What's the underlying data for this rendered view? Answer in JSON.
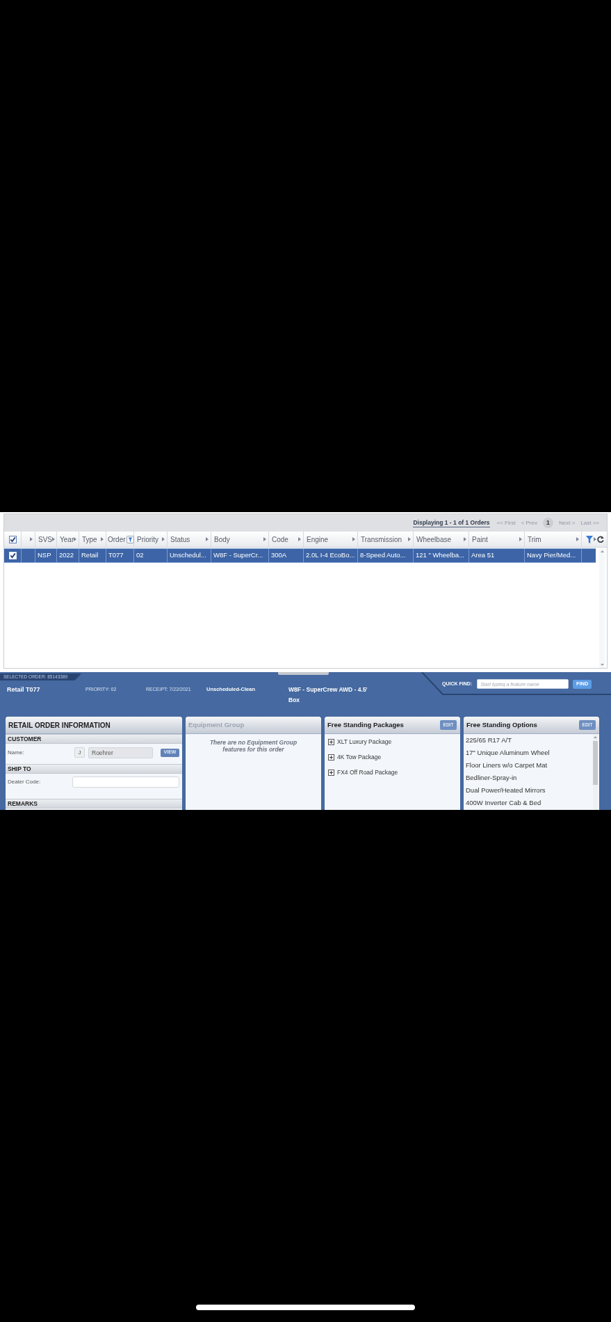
{
  "grid": {
    "pager": {
      "summary": "Displaying 1 - 1 of 1 Orders",
      "nav": [
        {
          "kind": "link",
          "label": "<< First",
          "disabled": true
        },
        {
          "kind": "link",
          "label": "< Prev",
          "disabled": true
        },
        {
          "kind": "page",
          "label": "1",
          "selected": true
        },
        {
          "kind": "link",
          "label": "Next >",
          "disabled": true
        },
        {
          "kind": "link",
          "label": "Last >>",
          "disabled": true
        }
      ]
    },
    "select_all_checked": true,
    "columns": [
      {
        "label": "SVS",
        "filter": false
      },
      {
        "label": "Year",
        "filter": false
      },
      {
        "label": "Type",
        "filter": false
      },
      {
        "label": "Order",
        "filter": true
      },
      {
        "label": "Priority",
        "filter": false
      },
      {
        "label": "Status",
        "filter": false
      },
      {
        "label": "Body",
        "filter": false
      },
      {
        "label": "Code",
        "filter": false
      },
      {
        "label": "Engine",
        "filter": false
      },
      {
        "label": "Transmission",
        "filter": false
      },
      {
        "label": "Wheelbase",
        "filter": false
      },
      {
        "label": "Paint",
        "filter": false
      },
      {
        "label": "Trim",
        "filter": false
      }
    ],
    "rows": [
      {
        "selected": true,
        "checked": true,
        "cells": [
          "NSP",
          "2022",
          "Retail",
          "T077",
          "02",
          "Unschedul...",
          "W8F - SuperCr...",
          "300A",
          "2.0L I-4 EcoBo...",
          "8-Speed Auto...",
          "121 \" Wheelba...",
          "Area 51",
          "Navy Pier/Med..."
        ]
      }
    ]
  },
  "selected_order": {
    "tab": "SELECTED ORDER: 85143389",
    "title": "Retail T077",
    "priority": "PRIORITY: 02",
    "receipt": "RECEIPT: 7/22/2021",
    "status": "Unscheduled-Clean",
    "body": "W8F - SuperCrew AWD - 4.5' Box"
  },
  "quick_find": {
    "label": "QUICK FIND:",
    "placeholder": "Start typing a feature name",
    "button": "FIND"
  },
  "order_info": {
    "title": "RETAIL ORDER INFORMATION",
    "customer": {
      "heading": "CUSTOMER",
      "label": "Name:",
      "initial": "J",
      "name": "Roehrer",
      "button": "VIEW"
    },
    "ship_to": {
      "heading": "SHIP TO",
      "label": "Dealer Code:"
    },
    "remarks": {
      "heading": "REMARKS"
    }
  },
  "equipment_group": {
    "title": "Equipment Group",
    "disabled": true,
    "message": "There are no Equipment Group features for this order"
  },
  "packages": {
    "title": "Free Standing Packages",
    "button": "EDIT",
    "items": [
      {
        "label": "XLT Luxury Package",
        "expanded": false
      },
      {
        "label": "4K Tow Package",
        "expanded": false
      },
      {
        "label": "FX4 Off Road Package",
        "expanded": false
      }
    ]
  },
  "options": {
    "title": "Free Standing Options",
    "button": "EDIT",
    "items": [
      "225/65 R17 A/T",
      "17\" Unique Aluminum Wheel",
      "Floor Liners w/o Carpet Mat",
      "Bedliner-Spray-in",
      "Dual Power/Heated Mirrors",
      "400W Inverter Cab & Bed"
    ]
  }
}
